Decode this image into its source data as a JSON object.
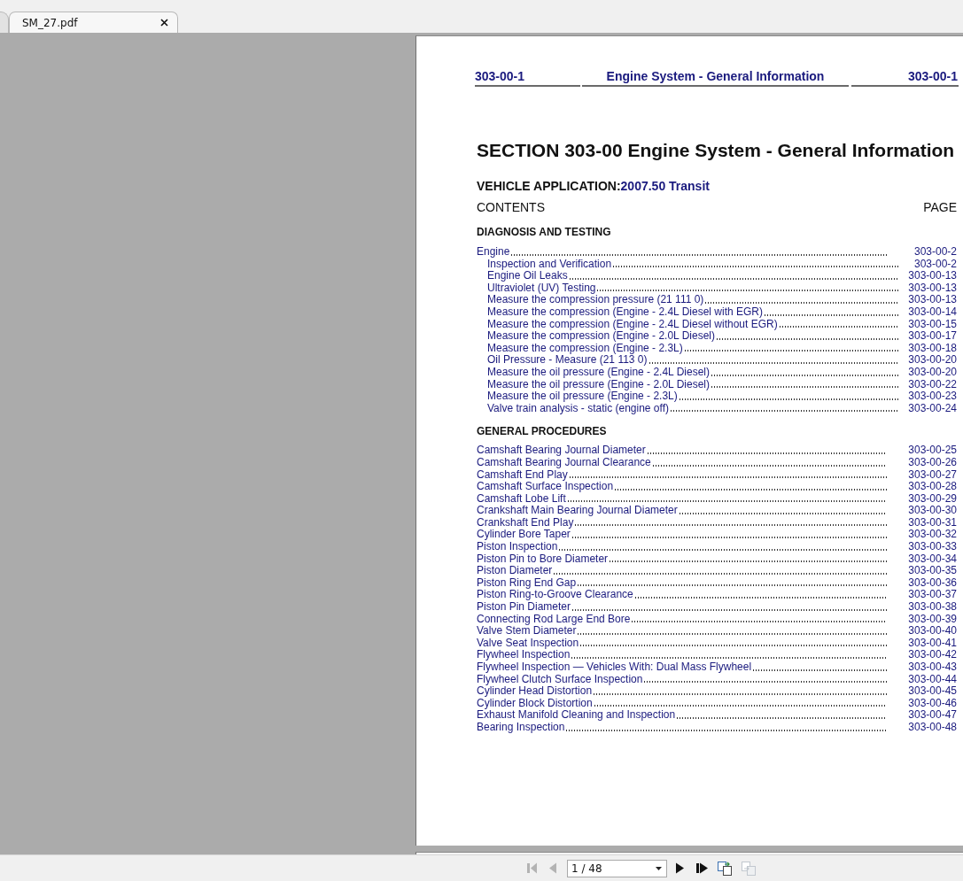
{
  "tabs": [
    {
      "selected": false
    },
    {
      "label": "SM_27.pdf",
      "selected": true
    }
  ],
  "page": {
    "header": {
      "left": "303-00-1",
      "center": "Engine System - General Information",
      "right": "303-00-1"
    },
    "title": "SECTION 303-00 Engine System - General Information",
    "vehicle_application": {
      "label": "VEHICLE APPLICATION:",
      "value": "2007.50 Transit"
    },
    "contents_label": "CONTENTS",
    "page_label": "PAGE",
    "sections": [
      {
        "heading": "DIAGNOSIS AND TESTING",
        "entries": [
          {
            "title": "Engine",
            "page": "303-00-2",
            "children": [
              {
                "title": "Inspection and Verification",
                "page": "303-00-2"
              },
              {
                "title": "Engine Oil Leaks",
                "page": "303-00-13"
              },
              {
                "title": "Ultraviolet (UV) Testing",
                "page": "303-00-13"
              },
              {
                "title": "Measure the compression pressure (21 111 0)",
                "page": "303-00-13"
              },
              {
                "title": "Measure the compression (Engine - 2.4L Diesel with EGR)",
                "page": "303-00-14"
              },
              {
                "title": "Measure the compression (Engine - 2.4L Diesel without EGR)",
                "page": "303-00-15"
              },
              {
                "title": "Measure the compression (Engine - 2.0L Diesel)",
                "page": "303-00-17"
              },
              {
                "title": "Measure the compression (Engine - 2.3L)",
                "page": "303-00-18"
              },
              {
                "title": "Oil Pressure - Measure (21 113 0)",
                "page": "303-00-20"
              },
              {
                "title": "Measure the oil pressure (Engine - 2.4L Diesel)",
                "page": "303-00-20"
              },
              {
                "title": "Measure the oil pressure (Engine - 2.0L Diesel)",
                "page": "303-00-22"
              },
              {
                "title": "Measure the oil pressure (Engine - 2.3L)",
                "page": "303-00-23"
              },
              {
                "title": "Valve train analysis - static (engine off)",
                "page": "303-00-24"
              }
            ]
          }
        ]
      },
      {
        "heading": "GENERAL PROCEDURES",
        "entries": [
          {
            "title": "Camshaft Bearing Journal Diameter",
            "page": "303-00-25"
          },
          {
            "title": "Camshaft Bearing Journal Clearance",
            "page": "303-00-26"
          },
          {
            "title": "Camshaft End Play",
            "page": "303-00-27"
          },
          {
            "title": "Camshaft Surface Inspection",
            "page": "303-00-28"
          },
          {
            "title": "Camshaft Lobe Lift",
            "page": "303-00-29"
          },
          {
            "title": "Crankshaft Main Bearing Journal Diameter",
            "page": "303-00-30"
          },
          {
            "title": "Crankshaft End Play",
            "page": "303-00-31"
          },
          {
            "title": "Cylinder Bore Taper",
            "page": "303-00-32"
          },
          {
            "title": "Piston Inspection",
            "page": "303-00-33"
          },
          {
            "title": "Piston Pin to Bore Diameter",
            "page": "303-00-34"
          },
          {
            "title": "Piston Diameter",
            "page": "303-00-35"
          },
          {
            "title": "Piston Ring End Gap",
            "page": "303-00-36"
          },
          {
            "title": "Piston Ring-to-Groove Clearance",
            "page": "303-00-37"
          },
          {
            "title": "Piston Pin Diameter",
            "page": "303-00-38"
          },
          {
            "title": "Connecting Rod Large End Bore",
            "page": "303-00-39"
          },
          {
            "title": "Valve Stem Diameter",
            "page": "303-00-40"
          },
          {
            "title": "Valve Seat Inspection",
            "page": "303-00-41"
          },
          {
            "title": "Flywheel Inspection",
            "page": "303-00-42"
          },
          {
            "title": "Flywheel Inspection — Vehicles With: Dual Mass Flywheel",
            "page": "303-00-43"
          },
          {
            "title": "Flywheel Clutch Surface Inspection",
            "page": "303-00-44"
          },
          {
            "title": "Cylinder Head Distortion",
            "page": "303-00-45"
          },
          {
            "title": "Cylinder Block Distortion",
            "page": "303-00-46"
          },
          {
            "title": "Exhaust Manifold Cleaning and Inspection",
            "page": "303-00-47"
          },
          {
            "title": "Bearing Inspection",
            "page": "303-00-48"
          }
        ]
      }
    ]
  },
  "toolbar": {
    "first_page": {
      "disabled": true
    },
    "previous_page": {
      "disabled": true
    },
    "page_field": {
      "value": "1 / 48"
    },
    "next_page": {
      "disabled": false
    },
    "last_page": {
      "disabled": false
    },
    "tool_buttons": [
      {
        "kind": "pages_arrows",
        "disabled": false
      },
      {
        "kind": "pages",
        "disabled": true
      }
    ]
  }
}
